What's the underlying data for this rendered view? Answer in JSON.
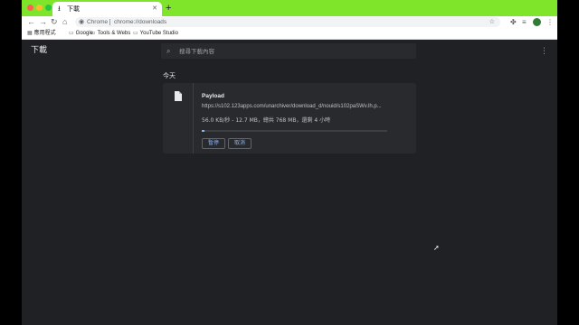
{
  "browser": {
    "tab": {
      "icon": "download-icon",
      "title": "下載",
      "close": "✕"
    },
    "new_tab": "+",
    "toolbar": {
      "back": "←",
      "forward": "→",
      "reload": "↻",
      "home": "⌂",
      "site_chip": "Chrome",
      "url": "chrome://downloads",
      "bookmark_star": "☆",
      "extensions": "✤",
      "reading_list": "≡",
      "menu": "⋮"
    },
    "bookmarks": [
      {
        "icon": "apps-grid-icon",
        "label": "應用程式"
      },
      {
        "icon": "folder-icon",
        "label": "Google"
      },
      {
        "icon": "folder-icon",
        "label": "Tools & Webs"
      },
      {
        "icon": "folder-icon",
        "label": "YouTube Studio"
      }
    ]
  },
  "downloads": {
    "title": "下載",
    "search": {
      "placeholder": "搜尋下載內容"
    },
    "menu": "⋮",
    "date_header": "今天",
    "items": [
      {
        "name": "Payload",
        "url": "https://s102.123apps.com/unarchiver/download_d/nouid/s102paSWv.lh.p...",
        "status": "56.0 KB/秒 - 12.7 MB，總共 768 MB，還剩 4 小時",
        "progress_fraction": 0.017,
        "actions": {
          "pause": "暫停",
          "cancel": "取消"
        }
      }
    ]
  },
  "colors": {
    "tab_strip": "#7fe52b",
    "page_bg": "#202124",
    "card_bg": "#292a2d",
    "accent": "#8ab4f8"
  }
}
